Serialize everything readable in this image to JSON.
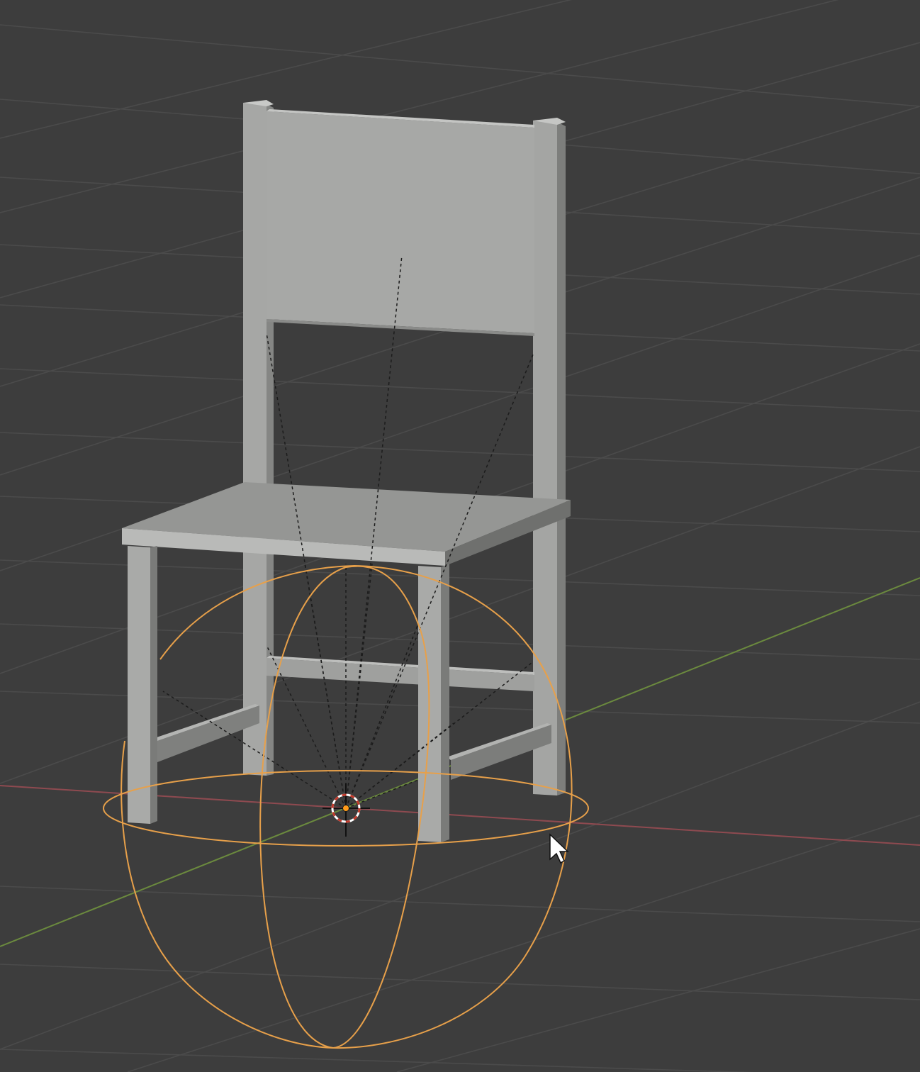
{
  "viewport": {
    "background": "#3d3d3d",
    "grid_color": "#4a4a4a",
    "axis_x_color": "#8e4a50",
    "axis_y_color": "#6b8a3e"
  },
  "scene": {
    "object": "chair",
    "chair_color": "#a6a7a5",
    "selected_empty": "sphere",
    "selected_color": "#e7a04a",
    "origin_point_color": "#ff9b1a"
  },
  "cursor": {
    "icon": "mouse-pointer-icon"
  }
}
